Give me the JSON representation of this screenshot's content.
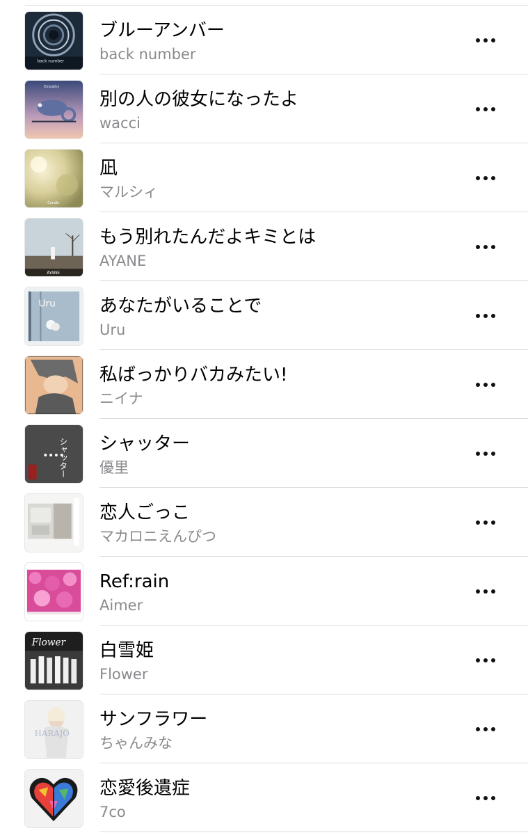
{
  "songs": [
    {
      "title": "ブルーアンバー",
      "artist": "back number",
      "art_icon": "album-art-spiral-staircase",
      "art_text": "back number"
    },
    {
      "title": "別の人の彼女になったよ",
      "artist": "wacci",
      "art_icon": "album-art-chameleon",
      "art_text": "Empathy"
    },
    {
      "title": "凪",
      "artist": "マルシィ",
      "art_icon": "album-art-bokeh",
      "art_text": "Candle"
    },
    {
      "title": "もう別れたんだよキミとは",
      "artist": "AYANE",
      "art_icon": "album-art-field",
      "art_text": "AYANE"
    },
    {
      "title": "あなたがいることで",
      "artist": "Uru",
      "art_icon": "album-art-window",
      "art_text": "Uru"
    },
    {
      "title": "私ばっかりバカみたい!",
      "artist": "ニイナ",
      "art_icon": "album-art-illustration",
      "art_text": ""
    },
    {
      "title": "シャッター",
      "artist": "優里",
      "art_icon": "album-art-shutter",
      "art_text": "シャッター"
    },
    {
      "title": "恋人ごっこ",
      "artist": "マカロニえんぴつ",
      "art_icon": "album-art-room",
      "art_text": ""
    },
    {
      "title": "Ref:rain",
      "artist": "Aimer",
      "art_icon": "album-art-flowers",
      "art_text": ""
    },
    {
      "title": "白雪姫",
      "artist": "Flower",
      "art_icon": "album-art-group",
      "art_text": "Flower"
    },
    {
      "title": "サンフラワー",
      "artist": "ちゃんみな",
      "art_icon": "album-art-portrait",
      "art_text": "HARAJO"
    },
    {
      "title": "恋愛後遺症",
      "artist": "7co",
      "art_icon": "album-art-heart",
      "art_text": ""
    }
  ],
  "colors": {
    "title": "#000000",
    "artist": "#8a8a8e",
    "divider": "#dcdcdc",
    "more_dots": "#111111"
  },
  "more_icon": "more-dots-icon"
}
